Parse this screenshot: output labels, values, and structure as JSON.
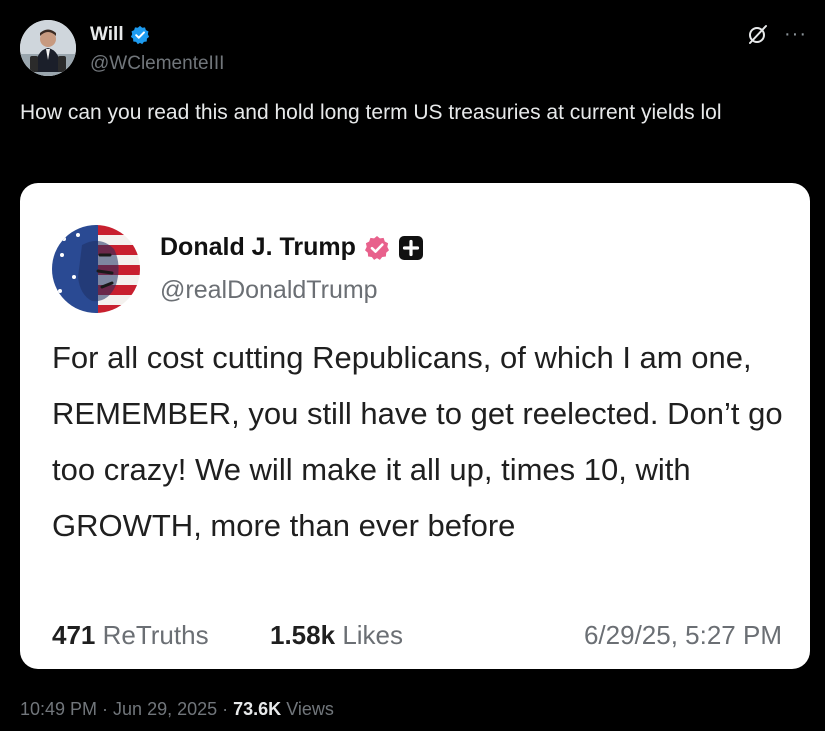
{
  "author": {
    "name": "Will",
    "handle": "@WClementeIII"
  },
  "header_icons": {
    "grok": "grok-icon",
    "more": "···"
  },
  "tweet": {
    "text": "How can you read this and hold long term US treasuries at current yields lol"
  },
  "embedded_post": {
    "author_name": "Donald J. Trump",
    "handle": "@realDonaldTrump",
    "body": "For all cost cutting Republicans, of which I am one, REMEMBER, you still have to get reelected. Don’t go too crazy! We will make it all up, times 10, with GROWTH, more than ever before",
    "retruths_count": "471",
    "retruths_label": "ReTruths",
    "likes_count": "1.58k",
    "likes_label": "Likes",
    "timestamp": "6/29/25, 5:27 PM"
  },
  "meta": {
    "time": "10:49 PM",
    "sep1": " · ",
    "date": "Jun 29, 2025",
    "sep2": " · ",
    "views_count": "73.6K",
    "views_label": " Views"
  },
  "colors": {
    "background": "#000000",
    "text_primary": "#e7e9ea",
    "text_secondary": "#71767b",
    "verified_blue": "#1d9bf0",
    "truth_badge": "#e8618c"
  }
}
